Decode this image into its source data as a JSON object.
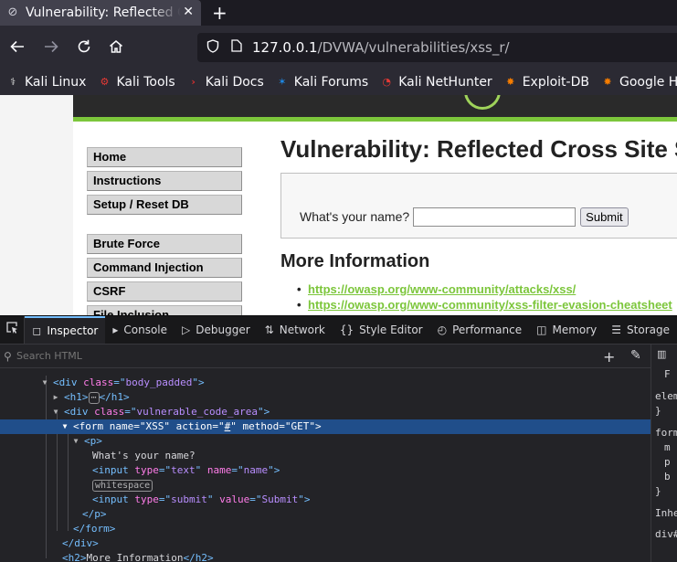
{
  "browser": {
    "tab_title": "Vulnerability: Reflected Cross Site Scripting (XSS) :: DVWA",
    "new_tab": "+",
    "close": "✕",
    "url_host": "127.0.0.1",
    "url_path": "/DVWA/vulnerabilities/xss_r/"
  },
  "bookmarks": [
    {
      "label": "Kali Linux",
      "icon": "kali-dragon-icon",
      "color": "#e5e5e5"
    },
    {
      "label": "Kali Tools",
      "icon": "kali-tools-icon",
      "color": "#e53935"
    },
    {
      "label": "Kali Docs",
      "icon": "kali-docs-icon",
      "color": "#d32f2f"
    },
    {
      "label": "Kali Forums",
      "icon": "kali-forums-icon",
      "color": "#1e88e5"
    },
    {
      "label": "Kali NetHunter",
      "icon": "nethunter-icon",
      "color": "#e53935"
    },
    {
      "label": "Exploit-DB",
      "icon": "exploitdb-icon",
      "color": "#f57c00"
    },
    {
      "label": "Google Hacking DB",
      "icon": "ghdb-icon",
      "color": "#f57c00"
    }
  ],
  "page": {
    "menu_group1": [
      "Home",
      "Instructions",
      "Setup / Reset DB"
    ],
    "menu_group2": [
      "Brute Force",
      "Command Injection",
      "CSRF",
      "File Inclusion"
    ],
    "title": "Vulnerability: Reflected Cross Site Scripting (XSS)",
    "prompt": "What's your name?",
    "submit": "Submit",
    "more_info": "More Information",
    "links": [
      "https://owasp.org/www-community/attacks/xss/",
      "https://owasp.org/www-community/xss-filter-evasion-cheatsheet"
    ]
  },
  "devtools": {
    "tabs": [
      "Inspector",
      "Console",
      "Debugger",
      "Network",
      "Style Editor",
      "Performance",
      "Memory",
      "Storage"
    ],
    "search_placeholder": "Search HTML",
    "markup": {
      "body_padded": "body_padded",
      "h1": "h1",
      "vulnerable_code_area": "vulnerable_code_area",
      "form_name": "XSS",
      "form_action": "#",
      "form_method": "GET",
      "p_text": "What's your name?",
      "input1_type": "text",
      "input1_name": "name",
      "whitespace": "whitespace",
      "input2_type": "submit",
      "input2_value": "Submit",
      "h2_text": "More Information"
    },
    "rules_pane": [
      "F",
      "elem",
      "}",
      "form",
      "m",
      "p",
      "b",
      "}",
      "Inhe",
      "div#"
    ]
  }
}
